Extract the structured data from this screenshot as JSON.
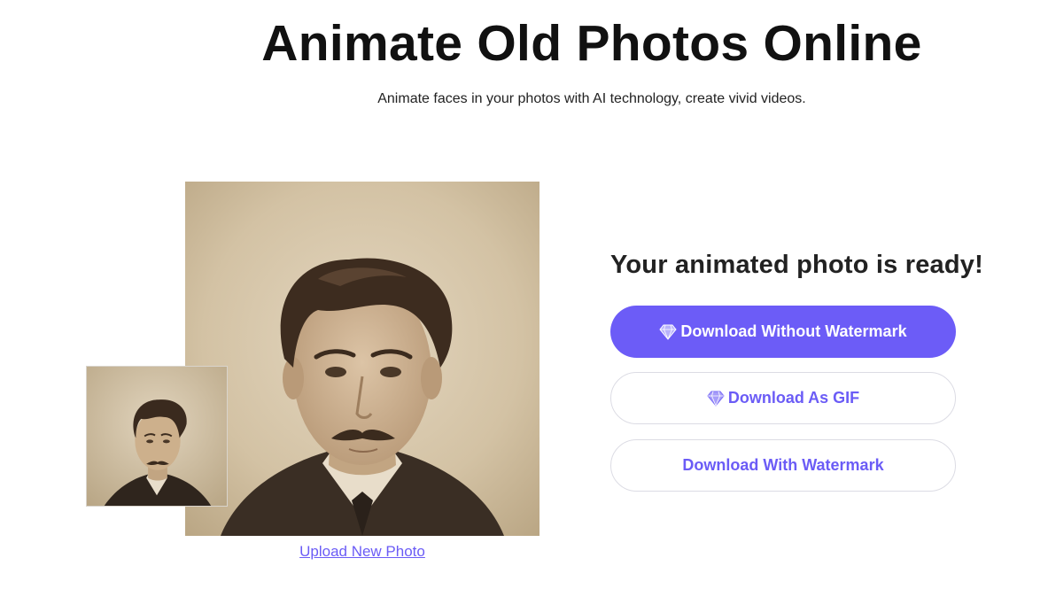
{
  "header": {
    "title": "Animate Old Photos Online",
    "subtitle": "Animate faces in your photos with AI technology, create vivid videos."
  },
  "preview": {
    "upload_link": "Upload New Photo"
  },
  "result": {
    "heading": "Your animated photo is ready!",
    "buttons": {
      "without_watermark": "Download Without Watermark",
      "as_gif": "Download As GIF",
      "with_watermark": "Download With Watermark"
    }
  },
  "colors": {
    "accent": "#6c5cf7",
    "text_dark": "#111111",
    "sepia_bg": "#d8c9ae"
  },
  "icons": {
    "premium": "diamond-icon"
  }
}
